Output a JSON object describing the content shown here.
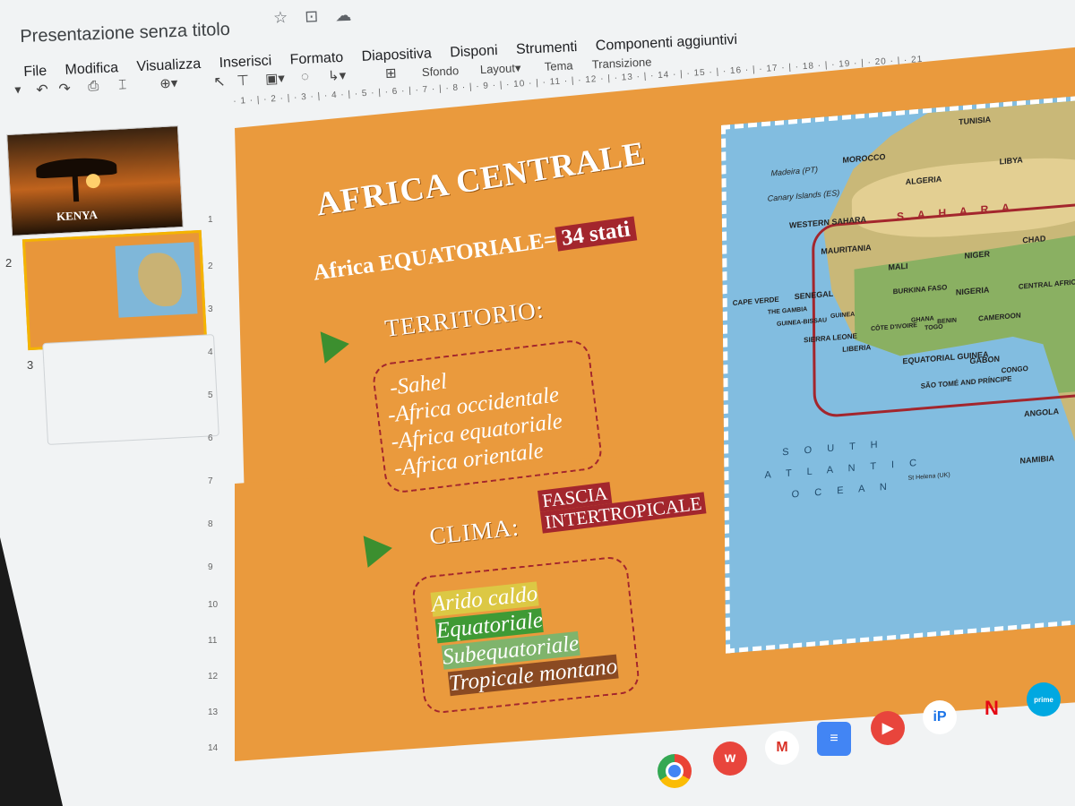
{
  "app": {
    "doc_title": "Presentazione senza titolo",
    "menu": [
      "File",
      "Modifica",
      "Visualizza",
      "Inserisci",
      "Formato",
      "Diapositiva",
      "Disponi",
      "Strumenti",
      "Componenti aggiuntivi"
    ],
    "toolbar": {
      "background_label": "Sfondo",
      "layout_label": "Layout",
      "theme_label": "Tema",
      "transition_label": "Transizione"
    },
    "ruler_h": "· 1 · | · 2 · | · 3 · | · 4 · | · 5 · | · 6 · | · 7 · | · 8 · | · 9 · | · 10 · | · 11 · | · 12 · | · 13 · | · 14 · | · 15 · | · 16 · | · 17 · | · 18 · | · 19 · | · 20 · | · 21",
    "ruler_v": [
      "1",
      "2",
      "3",
      "4",
      "5",
      "6",
      "7",
      "8",
      "9",
      "10",
      "11",
      "12",
      "13",
      "14"
    ]
  },
  "filmstrip": {
    "slides": [
      {
        "number": "",
        "title": "KENYA"
      },
      {
        "number": "2",
        "title": ""
      },
      {
        "number": "3",
        "title": ""
      }
    ]
  },
  "slide": {
    "title": "AFRICA CENTRALE",
    "subtitle": "Africa EQUATORIALE=",
    "subtitle_badge": "34 stati",
    "territorio_heading": "TERRITORIO:",
    "territorio_items": [
      "-Sahel",
      "-Africa occidentale",
      "-Africa equatoriale",
      "-Africa orientale"
    ],
    "clima_heading": "CLIMA:",
    "clima_label_line1": "FASCIA",
    "clima_label_line2": "INTERTROPICALE",
    "clima_items": [
      "Arido caldo",
      "Equatoriale",
      "Subequatoriale",
      "Tropicale montano"
    ]
  },
  "map": {
    "labels": [
      "Madeira (PT)",
      "MOROCCO",
      "Canary Islands (ES)",
      "TUNISIA",
      "WESTERN SAHARA",
      "ALGERIA",
      "LIBYA",
      "S A H A R A",
      "MAURITANIA",
      "MALI",
      "NIGER",
      "CHAD",
      "SENEGAL",
      "THE GAMBIA",
      "GUINEA-BISSAU",
      "GUINEA",
      "BURKINA FASO",
      "NIGERIA",
      "SIERRA LEONE",
      "LIBERIA",
      "CÔTE D'IVOIRE",
      "GHANA",
      "TOGO",
      "BENIN",
      "CENTRAL AFRICAN REP.",
      "CAMEROON",
      "EQUATORIAL GUINEA",
      "GABON",
      "CONGO",
      "SÃO TOMÉ AND PRÍNCIPE",
      "ANGOLA",
      "NAMIBIA",
      "St Helena (UK)",
      "CAPE VERDE"
    ],
    "ocean_label_1": "S O U T H",
    "ocean_label_2": "A T L A N T I C",
    "ocean_label_3": "O C E A N"
  }
}
